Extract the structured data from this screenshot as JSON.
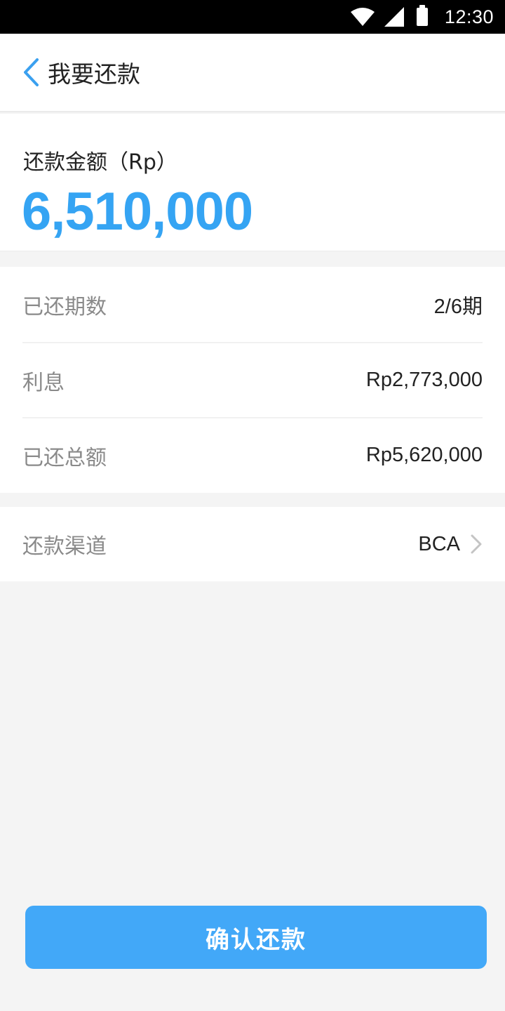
{
  "status_bar": {
    "time": "12:30",
    "icons": [
      "wifi-icon",
      "cell-signal-icon",
      "battery-icon"
    ]
  },
  "header": {
    "back_icon": "chevron-left-icon",
    "title": "我要还款"
  },
  "amount": {
    "label": "还款金额（Rp）",
    "value": "6,510,000"
  },
  "details": [
    {
      "label": "已还期数",
      "value": "2/6期"
    },
    {
      "label": "利息",
      "value": "Rp2,773,000"
    },
    {
      "label": "已还总额",
      "value": "Rp5,620,000"
    }
  ],
  "channel": {
    "label": "还款渠道",
    "value": "BCA",
    "icon": "chevron-right-icon"
  },
  "confirm_button": {
    "label": "确认还款"
  },
  "colors": {
    "accent": "#35a4f3",
    "button": "#42a8f8",
    "background": "#f4f4f4",
    "label_gray": "#8a8a8a",
    "text_dark": "#222222"
  }
}
